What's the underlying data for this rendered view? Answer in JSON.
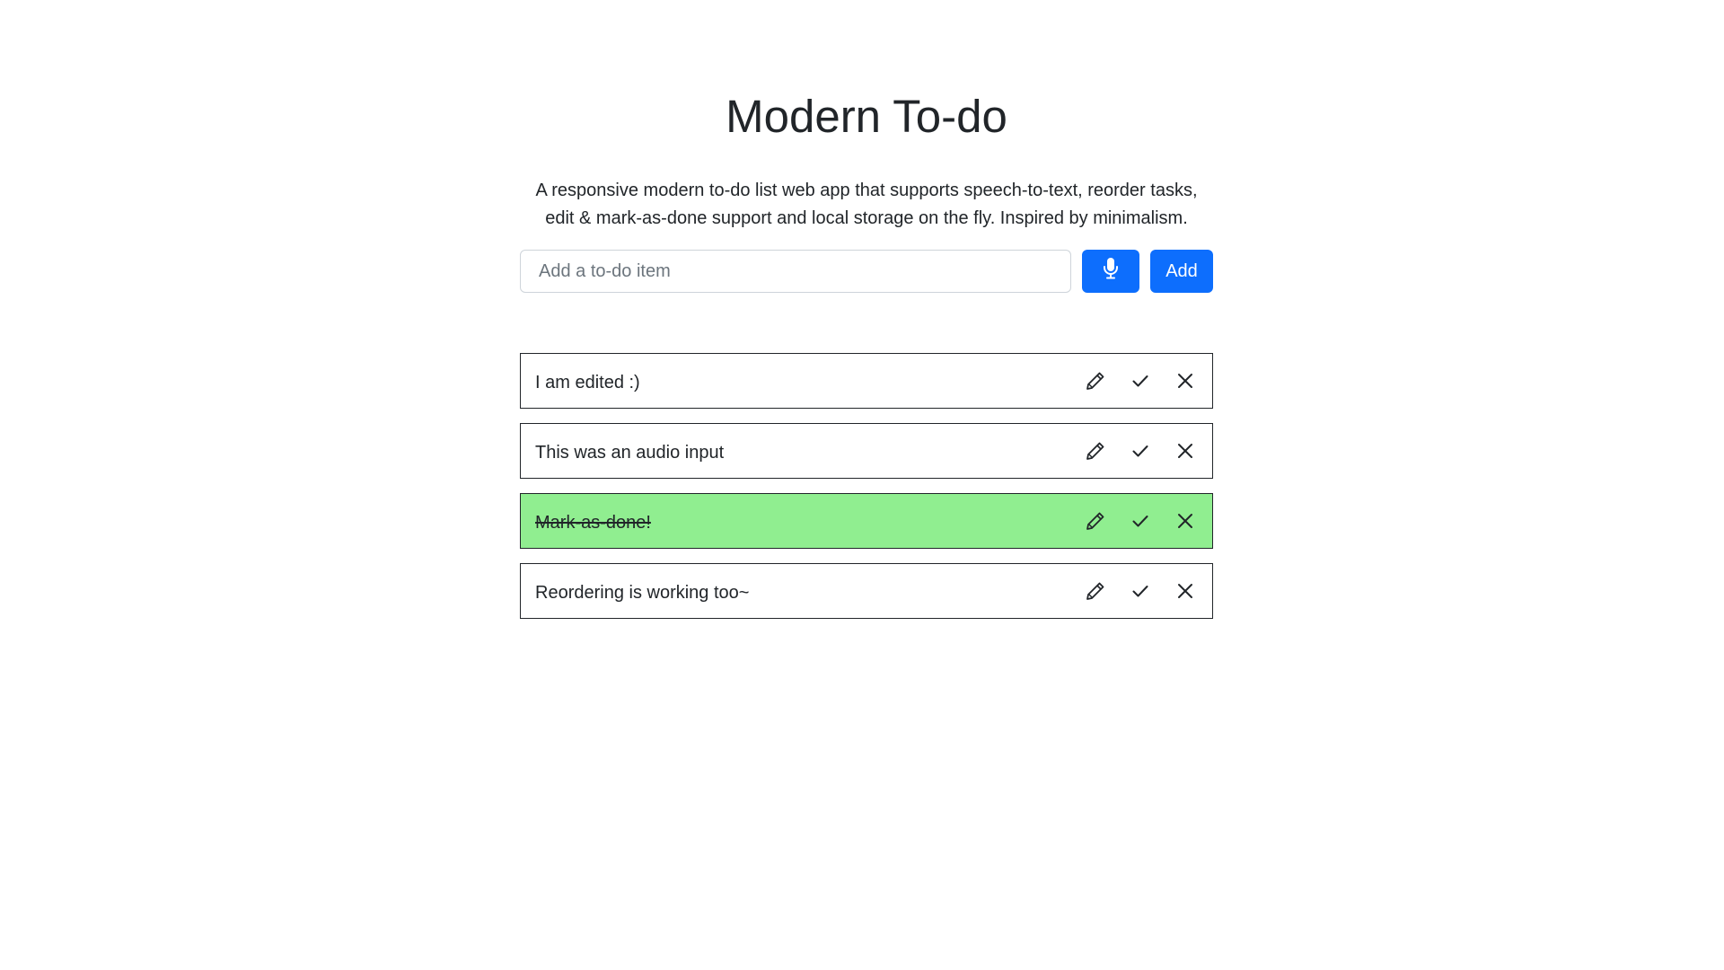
{
  "header": {
    "title": "Modern To-do",
    "description": "A responsive modern to-do list web app that supports speech-to-text, reorder tasks, edit & mark-as-done support and local storage on the fly. Inspired by minimalism."
  },
  "input": {
    "placeholder": "Add a to-do item",
    "value": "",
    "mic_icon": "microphone-icon",
    "add_label": "Add"
  },
  "colors": {
    "primary": "#0d6efd",
    "done_background": "#90ee90",
    "text": "#212529"
  },
  "todos": [
    {
      "text": "I am edited :)",
      "done": false
    },
    {
      "text": "This was an audio input",
      "done": false
    },
    {
      "text": "Mark-as-done!",
      "done": true
    },
    {
      "text": "Reordering is working too~",
      "done": false
    }
  ],
  "item_actions": [
    "pencil-icon",
    "check-icon",
    "close-icon"
  ]
}
